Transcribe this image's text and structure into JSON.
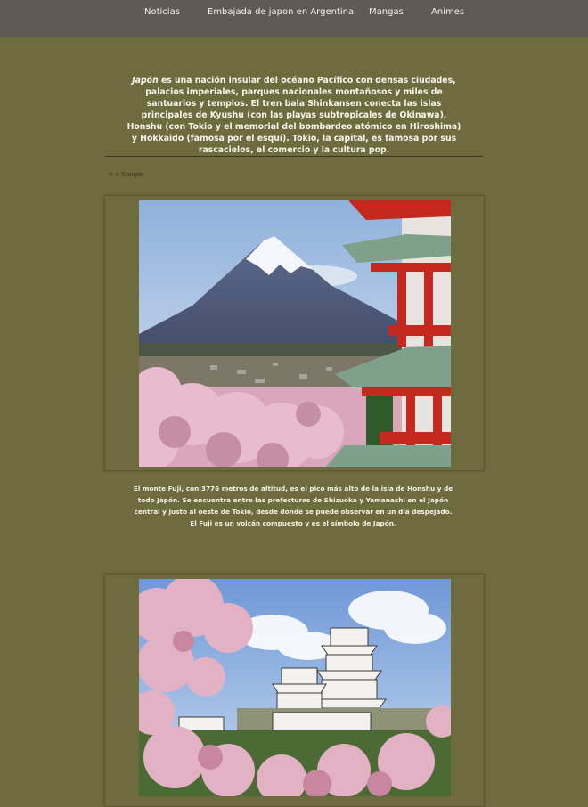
{
  "nav": {
    "items": [
      {
        "label": "Noticias"
      },
      {
        "label": "Embajada de japon en Argentina"
      },
      {
        "label": "Mangas"
      },
      {
        "label": "Animes"
      }
    ]
  },
  "intro": {
    "lead": "Japón",
    "text": " es una nación insular del océano Pacífico con densas ciudades, palacios imperiales, parques nacionales montañosos y miles de santuarios y templos. El tren bala Shinkansen conecta las islas principales de Kyushu (con las playas subtropicales de Okinawa), Honshu (con Tokio y el memorial del bombardeo atómico en Hiroshima) y Hokkaido (famosa por el esquí). Tokio, la capital, es famosa por sus rascacielos, el comercio y la cultura pop."
  },
  "link": {
    "label": "Ir a Google"
  },
  "caption1": "El monte Fuji, con 3776 metros de altitud, es el pico más alto de la isla de Honshu y de todo Japón. Se encuentra entre las prefecturas de Shizuoka y Yamanashi en el Japón central y justo al oeste de Tokio, desde donde se puede observar en un día despejado. El Fuji es un volcán compuesto y es el símbolo de Japón.",
  "colors": {
    "background": "#6e6b3f",
    "navbar": "#5f5a56"
  }
}
